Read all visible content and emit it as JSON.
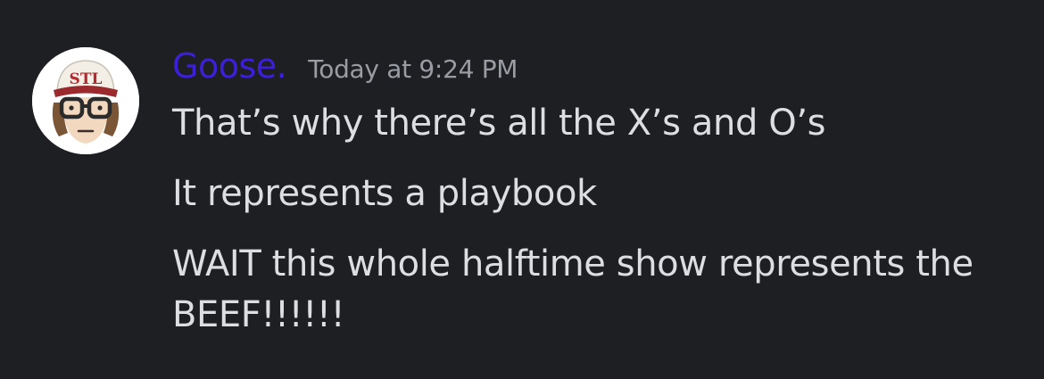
{
  "message_group": {
    "author": {
      "username": "Goose.",
      "username_color": "#3d1fd9",
      "avatar": "cartoon-face-cardinals-cap"
    },
    "timestamp": "Today at 9:24 PM",
    "messages": [
      {
        "text": "That’s why there’s all the X’s and O’s"
      },
      {
        "text": "It represents a playbook"
      },
      {
        "text": "WAIT this whole halftime show represents the BEEF!!!!!!"
      }
    ]
  },
  "colors": {
    "background": "#1e1f22",
    "message_text": "#dcdee2",
    "timestamp_text": "#9a9ca3"
  }
}
